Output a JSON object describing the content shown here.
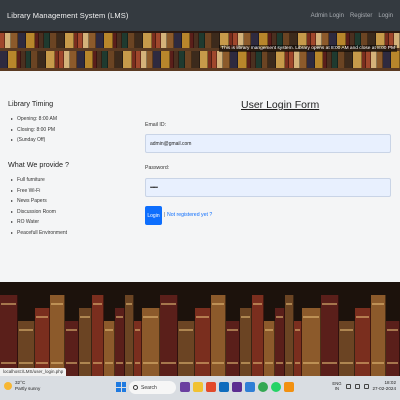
{
  "navbar": {
    "brand": "Library Management System (LMS)",
    "links": [
      "Admin Login",
      "Register",
      "Login"
    ]
  },
  "banner": {
    "marquee": "This is library mangement system. Library opens at 8:00 AM and close at 8:00 PM"
  },
  "sidebar": {
    "timing_heading": "Library Timing",
    "timing_items": [
      "Opening: 8:00 AM",
      "Closing: 8:00 PM",
      "(Sunday Off)"
    ],
    "provide_heading": "What We provide ?",
    "provide_items": [
      "Full furniture",
      "Free Wi-Fi",
      "News Papers",
      "Discussion Room",
      "RO Water",
      "Peacefull Environment"
    ]
  },
  "login_form": {
    "title": "User Login Form",
    "email_label": "Email ID:",
    "email_value": "admin@gmail.com",
    "password_label": "Password:",
    "password_value": "••••••",
    "login_button": "Login",
    "separator": "|",
    "register_link": "Not registered yet ?"
  },
  "status_bar": {
    "url": "localhost:/LMS/user_login.php"
  },
  "taskbar": {
    "weather_temp": "32°C",
    "weather_desc": "Partly sunny",
    "search_placeholder": "Search",
    "lang": "ENG",
    "lang_region": "IN",
    "time": "18:02",
    "date": "27-02-2024"
  },
  "colors": {
    "navbar": "#343a40",
    "primary": "#0d6efd",
    "field_bg": "#e8f0fe",
    "main_bg": "#f4f5f6"
  }
}
